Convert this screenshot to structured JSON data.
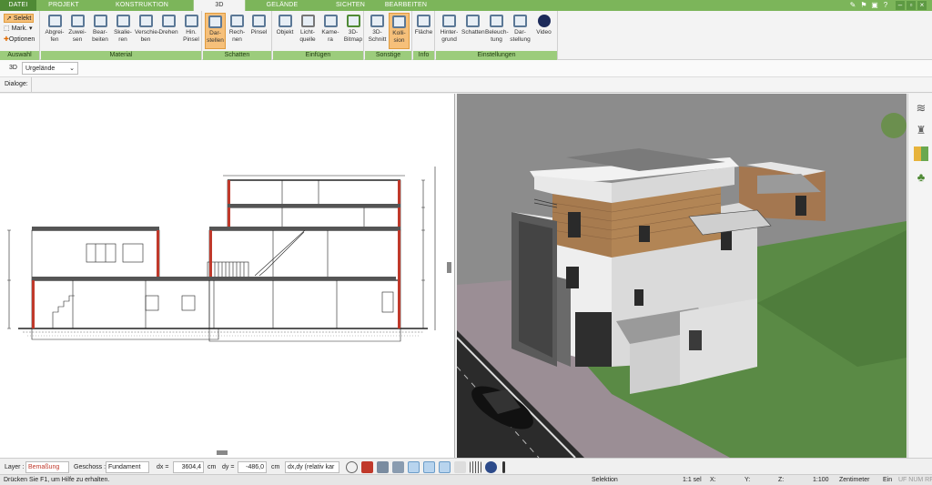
{
  "tabs": {
    "file": "DATEI",
    "projekt": "PROJEKT",
    "konstruktion": "KONSTRUKTION",
    "d3": "3D",
    "gelaende": "GELÄNDE",
    "sichten": "SICHTEN",
    "bearbeiten": "BEARBEITEN"
  },
  "ribbon": {
    "auswahl": {
      "label": "Auswahl",
      "selekt": "Selekt",
      "mark": "Mark.",
      "optionen": "Optionen"
    },
    "material": {
      "label": "Material",
      "items": [
        "Abgrei-\nfen",
        "Zuwei-\nsen",
        "Bear-\nbeiten",
        "Skalie-\nren",
        "Verschie-\nben",
        "Drehen",
        "Hin.\nPinsel"
      ]
    },
    "schatten": {
      "label": "Schatten",
      "items": [
        "Dar-\nstellen",
        "Rech-\nnen",
        "Pinsel"
      ]
    },
    "einfuegen": {
      "label": "Einfügen",
      "items": [
        "Objekt",
        "Licht-\nquelle",
        "Kame-\nra",
        "3D-\nBitmap"
      ]
    },
    "sonstige": {
      "label": "Sonstige",
      "items": [
        "3D-\nSchnitt",
        "Kolli-\nsion"
      ]
    },
    "info": {
      "label": "Info",
      "items": [
        "Fläche"
      ]
    },
    "einstellungen": {
      "label": "Einstellungen",
      "items": [
        "Hinter-\ngrund",
        "Schatten",
        "Beleuch-\ntung",
        "Dar-\nstellung",
        "Video"
      ]
    }
  },
  "viewbar": {
    "mode": "3D",
    "select_value": "Urgelände"
  },
  "dialoge": {
    "label": "Dialoge:"
  },
  "statusbar": {
    "layer_label": "Layer :",
    "layer_value": "Bemaßung",
    "geschoss_label": "Geschoss :",
    "geschoss_value": "Fundament",
    "dx_label": "dx =",
    "dx_value": "3604,4",
    "dx_unit": "cm",
    "dy_label": "dy =",
    "dy_value": "-486,0",
    "dy_unit": "cm",
    "mode_value": "dx,dy (relativ kar"
  },
  "footer": {
    "help": "Drücken Sie F1, um Hilfe zu erhalten.",
    "mode": "Selektion",
    "scale_sel": "1:1 sel",
    "x": "X:",
    "y": "Y:",
    "z": "Z:",
    "scale": "1:100",
    "unit": "Zentimeter",
    "ein": "Ein",
    "flags": "UF NUM RF"
  },
  "colors": {
    "accent": "#7cb55a",
    "active": "#f6c07a",
    "wall_red": "#c0392b"
  }
}
